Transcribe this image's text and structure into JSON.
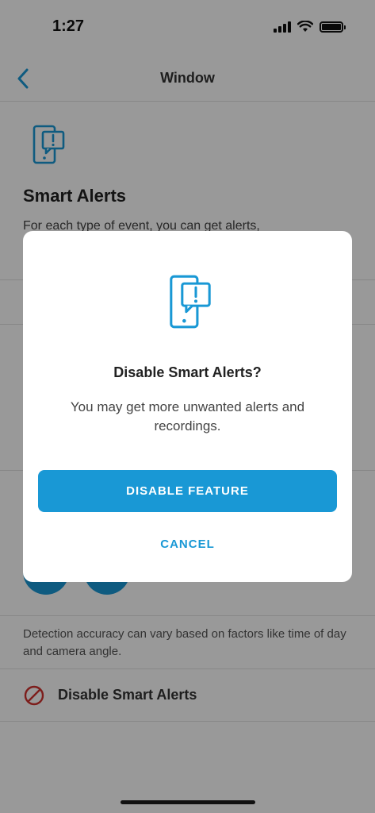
{
  "status_bar": {
    "time": "1:27"
  },
  "nav": {
    "title": "Window"
  },
  "page": {
    "title": "Smart Alerts",
    "description": "For each type of event, you can get alerts,",
    "footnote": "Detection accuracy can vary based on factors like time of day and camera angle.",
    "disable_row_label": "Disable Smart Alerts"
  },
  "modal": {
    "title": "Disable Smart Alerts?",
    "body": "You may get more unwanted alerts and recordings.",
    "primary_button": "DISABLE FEATURE",
    "cancel_button": "CANCEL"
  },
  "colors": {
    "accent": "#1998d5",
    "danger": "#d0312d",
    "overlay": "rgba(0,0,0,0.40)"
  },
  "icons": {
    "back": "chevron-left-icon",
    "alert_phone": "phone-alert-icon",
    "disable": "prohibited-icon"
  }
}
